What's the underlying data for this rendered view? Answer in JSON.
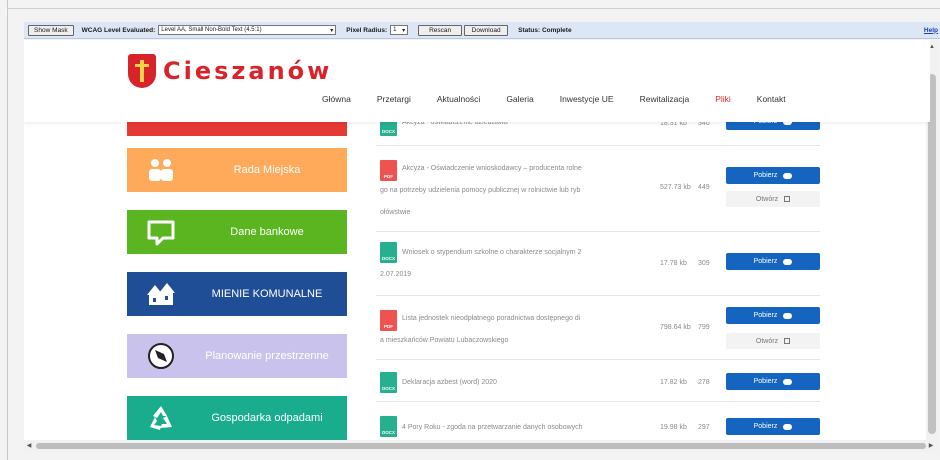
{
  "toolbar": {
    "show_mask": "Show Mask",
    "wcag_label": "WCAG Level Evaluated:",
    "wcag_value": "Level AA, Small Non-Bold Text (4.5:1)",
    "pixel_label": "Pixel Radius:",
    "pixel_value": "1",
    "rescan": "Rescan",
    "download": "Download",
    "status": "Status: Complete",
    "help": "Help"
  },
  "site": {
    "logo_text": "Cieszanów",
    "nav": [
      "Główna",
      "Przetargi",
      "Aktualności",
      "Galeria",
      "Inwestycje UE",
      "Rewitalizacja",
      "Pliki",
      "Kontakt"
    ],
    "active_nav": "Pliki"
  },
  "sidebar": {
    "tiles": [
      {
        "label": "",
        "color": "#e53935"
      },
      {
        "label": "Rada Miejska",
        "color": "#ffa95a"
      },
      {
        "label": "Dane bankowe",
        "color": "#5bb520"
      },
      {
        "label": "MIENIE KOMUNALNE",
        "color": "#1f4e96"
      },
      {
        "label": "Planowanie przestrzenne",
        "color": "#c9c2ec"
      },
      {
        "label": "Gospodarka odpadami",
        "color": "#19ad8d"
      }
    ]
  },
  "files": {
    "get_label": "Pobierz",
    "open_label": "Otwórz",
    "rows": [
      {
        "type": "DOCX",
        "lines": [
          "Akcyza - oświadczenie dziedzawa"
        ],
        "size": "18.31 kb",
        "count": "340"
      },
      {
        "type": "PDF",
        "lines": [
          "Akcyza - Oświadczenie wnioskodawcy – producenta rolne",
          "go na potrzeby udzielenia pomocy publicznej w rolnictwie lub ryb",
          "ołówstwie"
        ],
        "size": "527.73 kb",
        "count": "449"
      },
      {
        "type": "DOCX",
        "lines": [
          "Wniosek o stypendium szkolne o charakterze socjalnym 2",
          "2.07.2019"
        ],
        "size": "17.78 kb",
        "count": "309"
      },
      {
        "type": "PDF",
        "lines": [
          "Lista jednostek nieodpłatnego poradnictwa dostępnego di",
          "a mieszkańców Powiatu Lubaczowskiego"
        ],
        "size": "798.64 kb",
        "count": "799"
      },
      {
        "type": "DOCX",
        "lines": [
          "Deklaracja azbest (word) 2020"
        ],
        "size": "17.82 kb",
        "count": "278"
      },
      {
        "type": "DOCX",
        "lines": [
          "4 Pory Roku - zgoda na przetwarzanie danych osobowych"
        ],
        "size": "19.98 kb",
        "count": "297"
      }
    ]
  },
  "colors": {
    "brand_red": "#d8232a",
    "button_blue": "#1565c0",
    "pdf_red": "#ef5350",
    "docx_green": "#26b08f"
  }
}
